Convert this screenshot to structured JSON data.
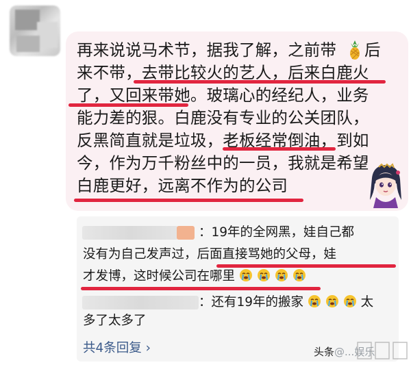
{
  "comment": {
    "lines": [
      "再来说说马术节，据我了解，之前带",
      "后",
      "来不带，去带比较火的艺人，后来白鹿火",
      "了，又回来带她。玻璃心的经纪人，业务",
      "能力差的狠。白鹿没有专业的公关团队，",
      "反黑简直就是垃圾，老板经常倒油，到如",
      "今，作为万千粉丝中的一员，我就是希望",
      "白鹿更好，远离不作为的公司"
    ],
    "emoji_icon": "pineapple-icon",
    "highlight_color": "#e1253f"
  },
  "replies": [
    {
      "lines": [
        "：19年的全网黑，娃自己都",
        "没有为自己发声过，后面直接骂她的父母，娃",
        "才发博，这时候公司在哪里"
      ]
    },
    {
      "lines": [
        "：还有19年的搬家",
        "太",
        "多了太多了"
      ]
    }
  ],
  "reply_more": "共4条回复 ›",
  "watermark": {
    "text": "头条",
    "suffix": "@...娱乐"
  }
}
